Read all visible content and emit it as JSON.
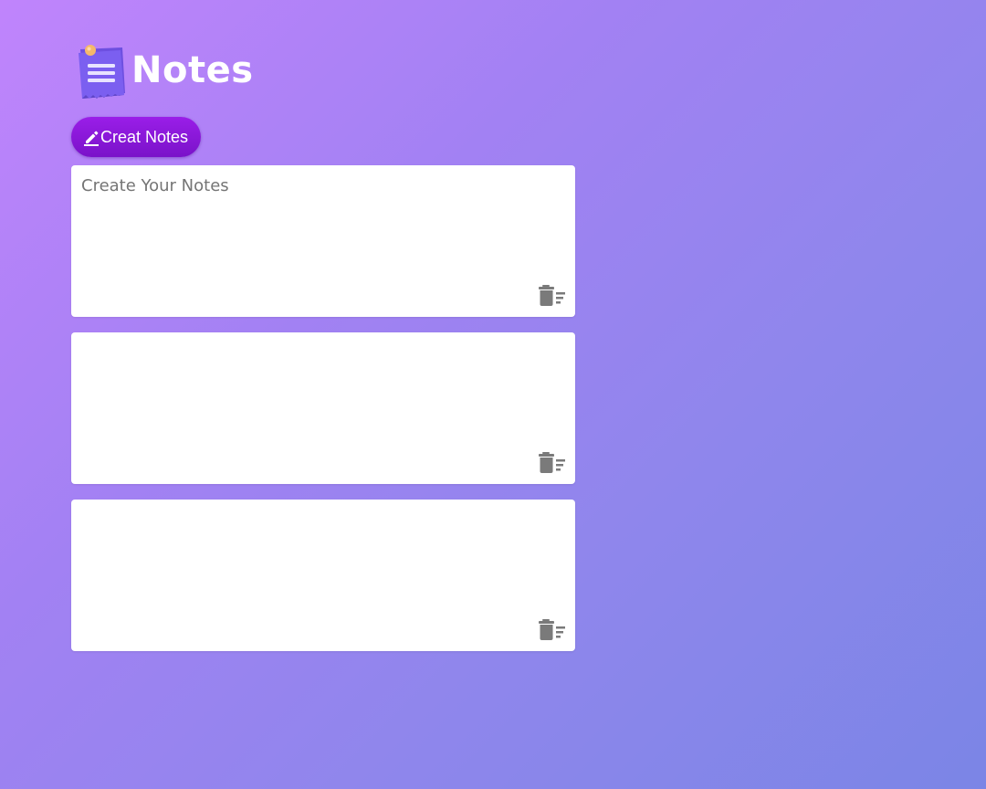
{
  "app": {
    "title": "Notes",
    "logo_icon": "notepad-icon"
  },
  "toolbar": {
    "create_label": "Creat Notes",
    "create_icon": "pen-icon"
  },
  "notes": [
    {
      "placeholder": "Create Your Notes",
      "value": "",
      "delete_icon": "trash-icon"
    },
    {
      "placeholder": "",
      "value": "",
      "delete_icon": "trash-icon"
    },
    {
      "placeholder": "",
      "value": "",
      "delete_icon": "trash-icon"
    }
  ],
  "colors": {
    "button_gradient_top": "#9a1ee8",
    "button_gradient_bottom": "#7a12c9",
    "background_start": "#c084fc",
    "background_end": "#7b85e6",
    "icon_gray": "#7a7a7a"
  }
}
